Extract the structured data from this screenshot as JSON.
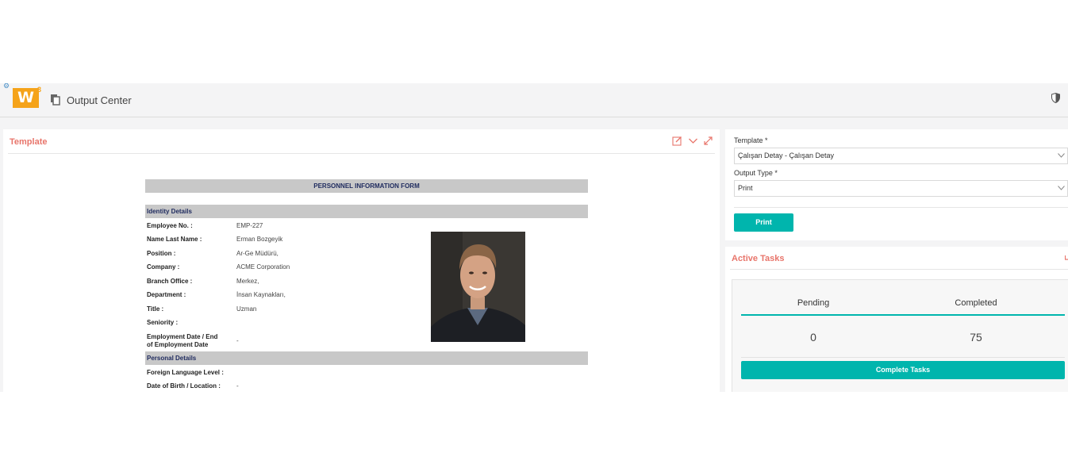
{
  "header": {
    "logo_text": "W",
    "logo_sup": "3",
    "page_title": "Output Center"
  },
  "template_panel": {
    "title": "Template"
  },
  "form": {
    "title": "PERSONNEL INFORMATION FORM",
    "identity_section": "Identity Details",
    "identity_fields": [
      {
        "label": "Employee No. :",
        "value": "EMP-227"
      },
      {
        "label": "Name Last Name :",
        "value": "Erman Bozgeyik"
      },
      {
        "label": "Position :",
        "value": "Ar-Ge Müdürü,"
      },
      {
        "label": "Company :",
        "value": "ACME Corporation"
      },
      {
        "label": "Branch Office :",
        "value": "Merkez,"
      },
      {
        "label": "Department :",
        "value": "İnsan Kaynakları,"
      },
      {
        "label": "Title :",
        "value": "Uzman"
      },
      {
        "label": "Seniority :",
        "value": ""
      },
      {
        "label_line1": "Employment Date / End",
        "label_line2": "of Employment Date",
        "value": "-"
      }
    ],
    "personal_section": "Personal Details",
    "personal_fields": [
      {
        "label": "Foreign Language Level :",
        "value": ""
      },
      {
        "label": "Date of Birth / Location :",
        "value": "-"
      }
    ]
  },
  "output_settings": {
    "template_label": "Template *",
    "template_value": "Çalışan Detay - Çalışan Detay",
    "output_type_label": "Output Type *",
    "output_type_value": "Print",
    "print_button": "Print"
  },
  "active_tasks": {
    "title": "Active Tasks",
    "pending_label": "Pending",
    "completed_label": "Completed",
    "pending_value": "0",
    "completed_value": "75",
    "complete_button": "Complete Tasks"
  },
  "colors": {
    "accent": "#00b5ad",
    "title_red": "#e8756b",
    "logo_orange": "#f5a31a",
    "form_bar": "#c8c8c8",
    "form_text": "#1e2a5e"
  }
}
